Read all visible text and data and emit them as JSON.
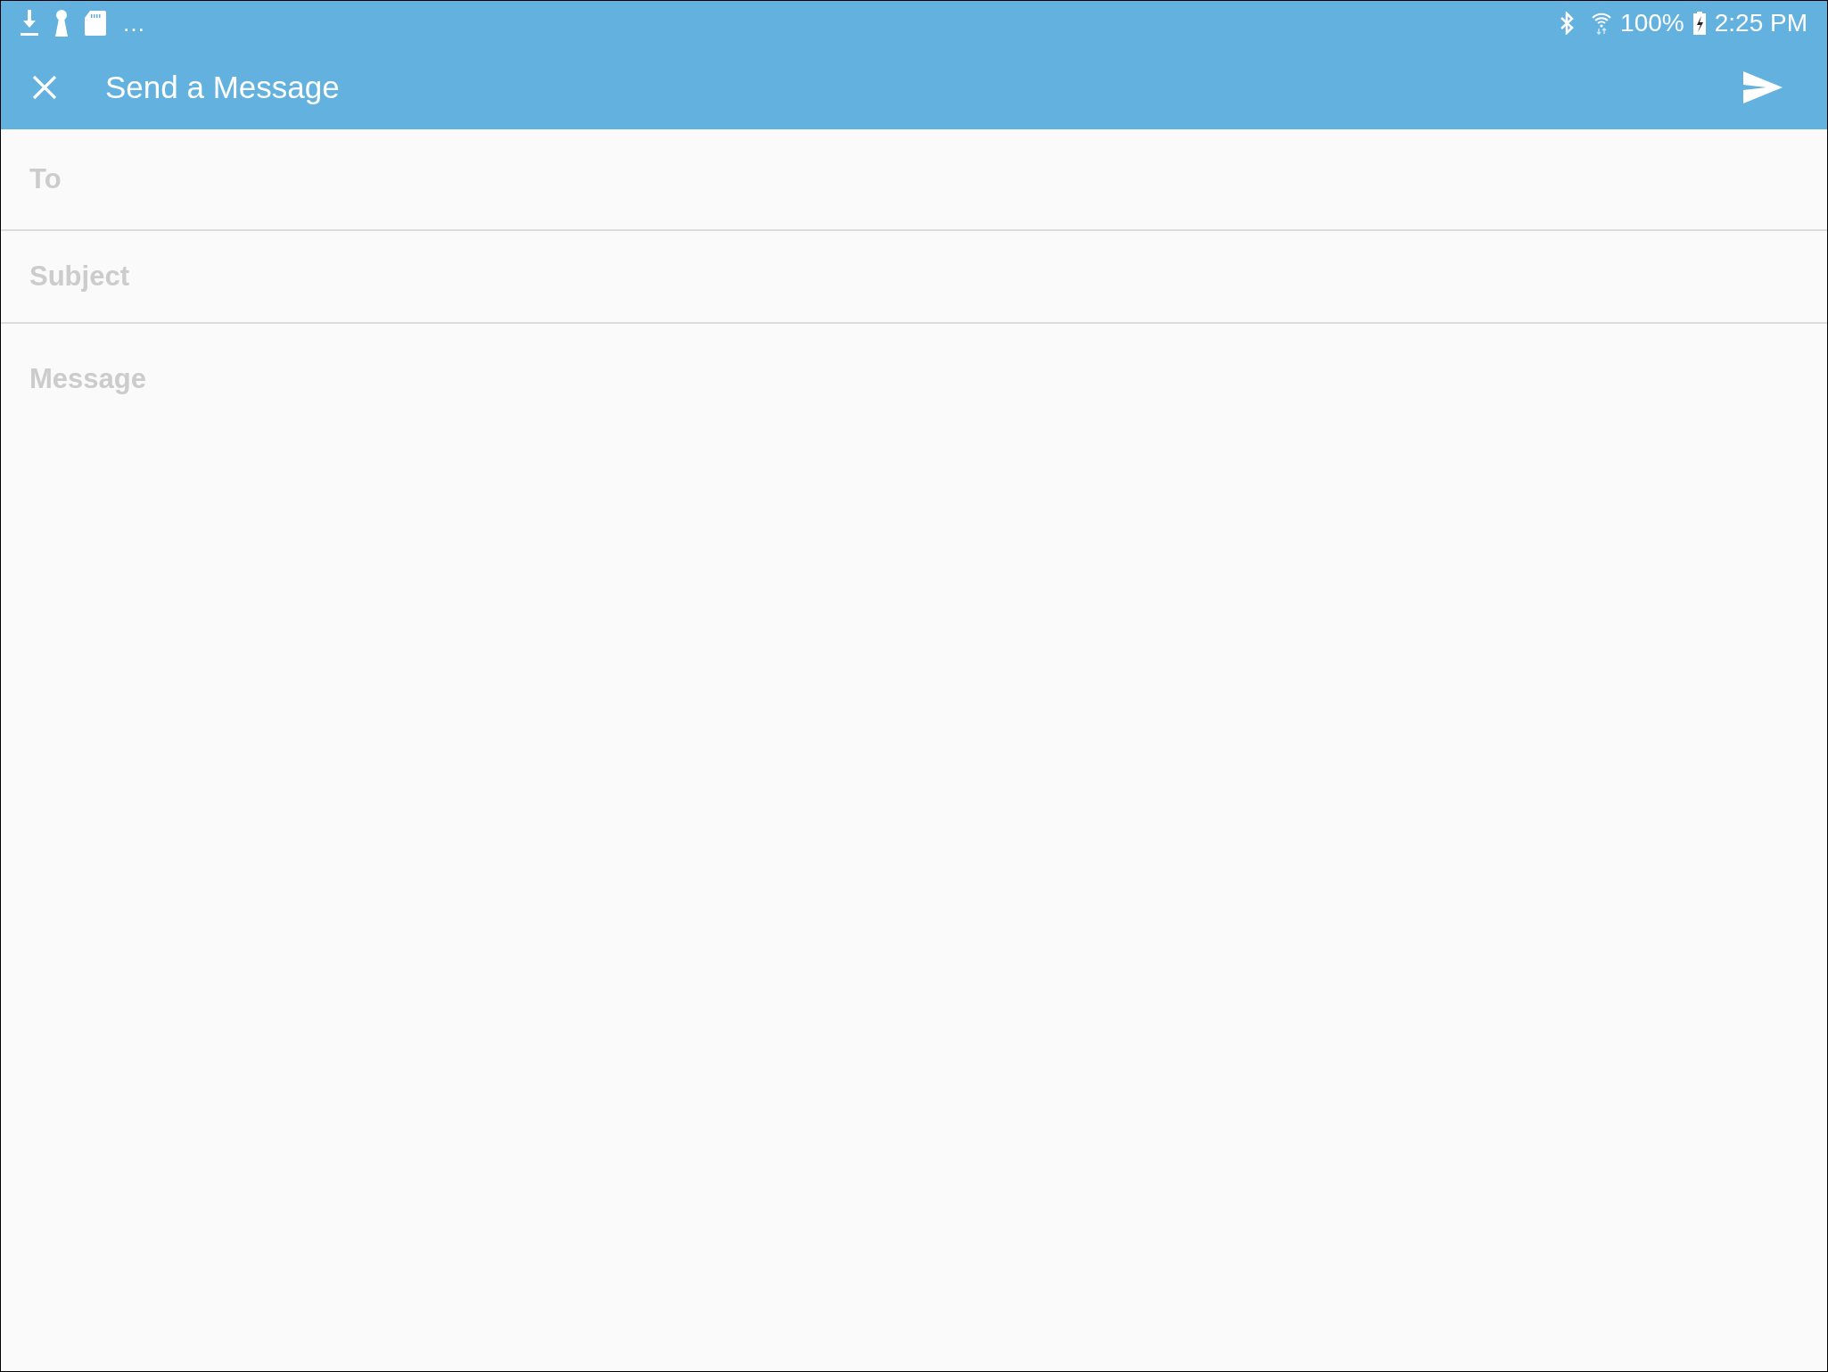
{
  "status_bar": {
    "overflow": "…",
    "battery": "100%",
    "time": "2:25 PM"
  },
  "app_bar": {
    "title": "Send a Message"
  },
  "fields": [
    {
      "kind": "line",
      "placeholder": "To"
    },
    {
      "kind": "line",
      "placeholder": "Subject"
    },
    {
      "kind": "area",
      "placeholder": "Message"
    }
  ]
}
